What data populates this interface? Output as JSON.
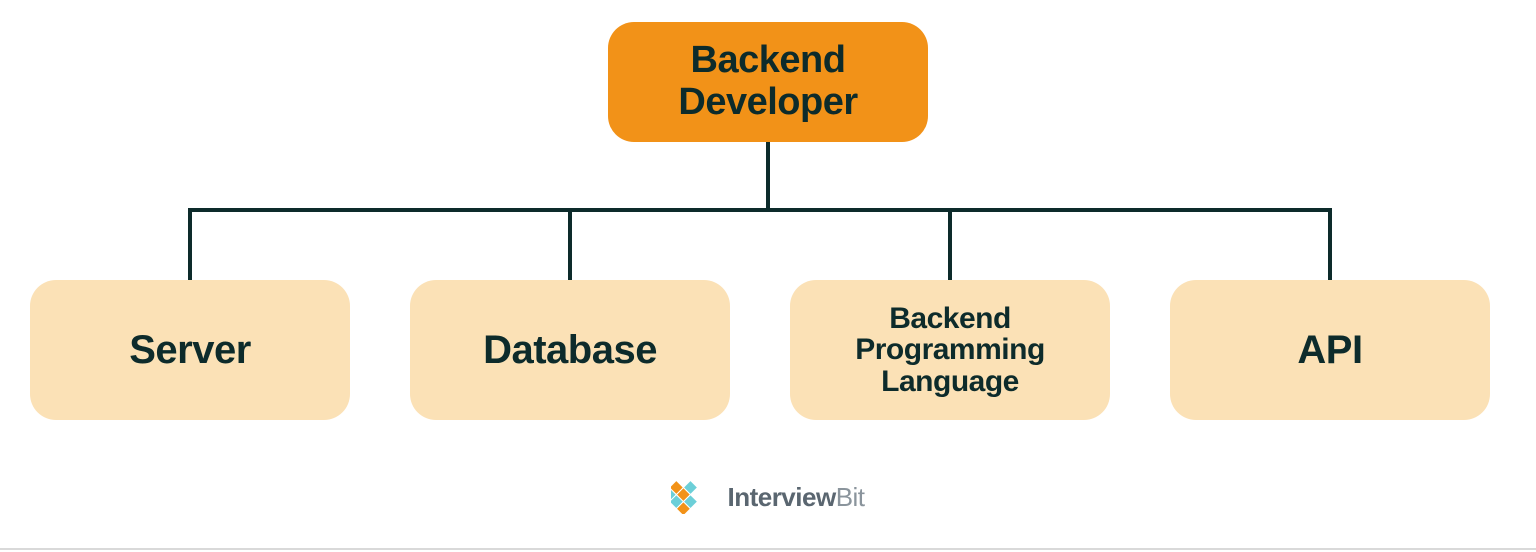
{
  "diagram": {
    "root": {
      "label": "Backend\nDeveloper"
    },
    "children": [
      {
        "label": "Server"
      },
      {
        "label": "Database"
      },
      {
        "label": "Backend\nProgramming\nLanguage"
      },
      {
        "label": "API"
      }
    ]
  },
  "colors": {
    "root_bg": "#F29218",
    "root_text": "#0D2B2B",
    "child_bg": "#FBE1B6",
    "child_text": "#0D2B2B",
    "connector": "#0D2B2B"
  },
  "brand": {
    "name_part1": "Interview",
    "name_part2": "Bit"
  }
}
